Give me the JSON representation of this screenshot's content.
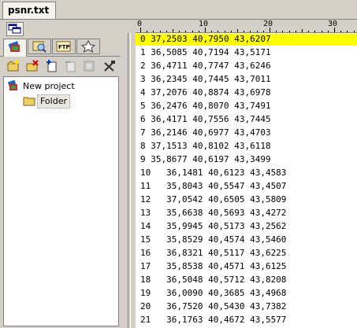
{
  "document_tab": {
    "label": "psnr.txt"
  },
  "panel_tabs": [
    {
      "icon": "project-icon",
      "active": true
    },
    {
      "icon": "file-browser-icon",
      "active": false
    },
    {
      "icon": "ftp-icon",
      "label": "FTP",
      "active": false
    },
    {
      "icon": "favorites-star-icon",
      "active": false
    }
  ],
  "toolbar": {
    "buttons": [
      "new-project-icon",
      "close-project-icon",
      "add-file-icon",
      "remove-file-icon",
      "properties-icon",
      "tools-icon"
    ]
  },
  "tree": {
    "root": {
      "label": "New project",
      "icon": "project-icon"
    },
    "children": [
      {
        "label": "Folder",
        "icon": "folder-icon"
      }
    ]
  },
  "ruler": {
    "marks": [
      "0",
      "10",
      "20",
      "30"
    ]
  },
  "lines": [
    "0 37,2503 40,7950 43,6207",
    "1 36,5085 40,7194 43,5171",
    "2 36,4711 40,7747 43,6246",
    "3 36,2345 40,7445 43,7011",
    "4 37,2076 40,8874 43,6978",
    "5 36,2476 40,8070 43,7491",
    "6 36,4171 40,7556 43,7445",
    "7 36,2146 40,6977 43,4703",
    "8 37,1513 40,8102 43,6118",
    "9 35,8677 40,6197 43,3499",
    "10   36,1481 40,6123 43,4583",
    "11   35,8043 40,5547 43,4507",
    "12   37,0542 40,6505 43,5809",
    "13   35,6638 40,5693 43,4272",
    "14   35,9945 40,5173 43,2562",
    "15   35,8529 40,4574 43,5460",
    "16   36,8321 40,5117 43,6225",
    "17   35,8538 40,4571 43,6125",
    "18   36,5048 40,5712 43,8208",
    "19   36,0090 40,3685 43,4968",
    "20   36,7520 40,5430 43,7382",
    "21   36,1763 40,4672 43,5577"
  ],
  "highlighted_line": 0,
  "colors": {
    "highlight": "#ffff00",
    "chrome": "#d4d0c8"
  }
}
